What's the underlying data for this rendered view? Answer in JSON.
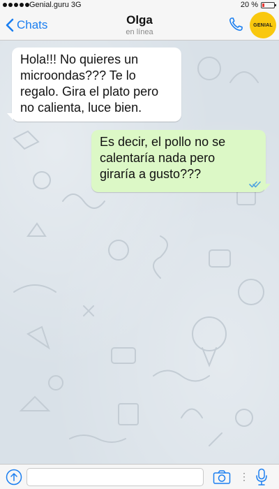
{
  "status_bar": {
    "carrier": "Genial.guru  3G",
    "battery_percent": "20 %",
    "battery_level": 0.2
  },
  "header": {
    "back_label": "Chats",
    "contact_name": "Olga",
    "contact_status": "en línea",
    "avatar_text": "GENIAL"
  },
  "messages": [
    {
      "direction": "incoming",
      "text": "Hola!!! No quieres un microondas??? Te lo regalo. Gira el plato pero no calienta, luce bien."
    },
    {
      "direction": "outgoing",
      "text": "Es decir, el pollo no se calentaría nada pero giraría a gusto???",
      "status": "read"
    }
  ],
  "input": {
    "placeholder": "",
    "value": ""
  },
  "colors": {
    "accent": "#1a7ef0",
    "outgoing_bubble": "#dcf8c6",
    "incoming_bubble": "#ffffff",
    "read_ticks": "#4fa3e0",
    "avatar_bg": "#f9c80e"
  },
  "icons": {
    "back": "chevron-left-icon",
    "phone": "phone-icon",
    "share": "share-arrow-icon",
    "camera": "camera-icon",
    "mic": "microphone-icon",
    "read_status": "double-check-icon"
  }
}
